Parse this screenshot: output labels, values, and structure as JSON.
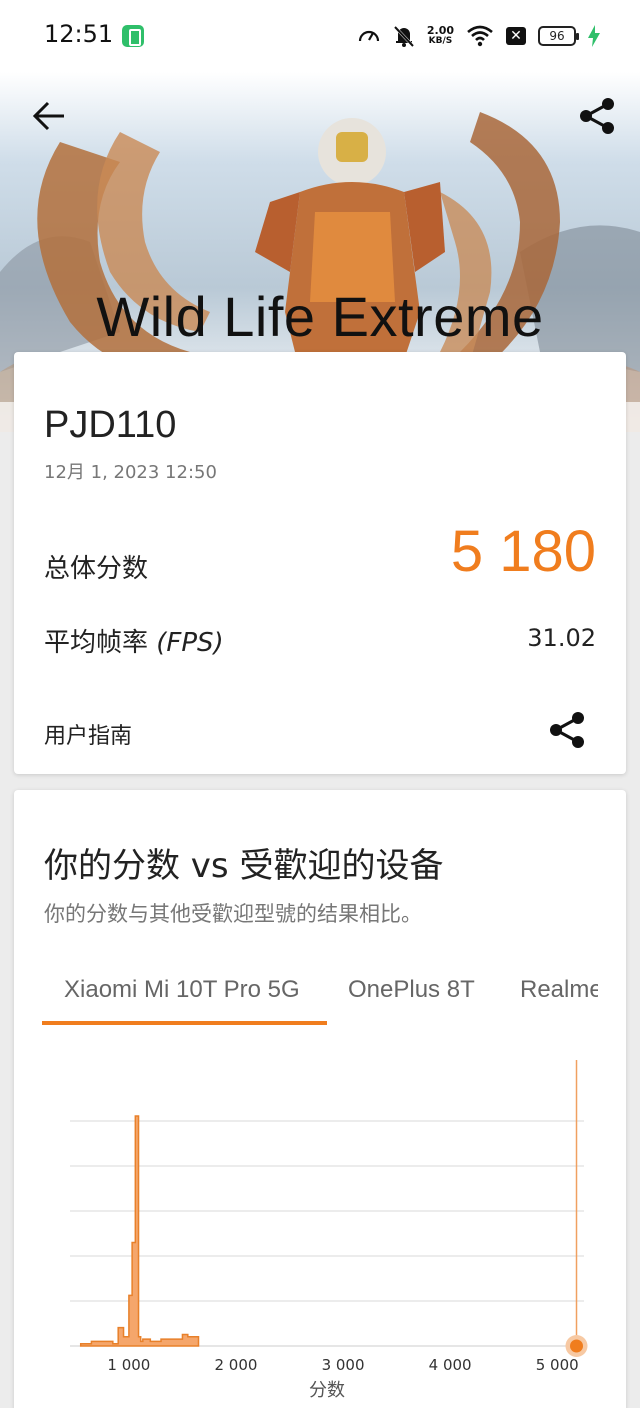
{
  "status_bar": {
    "time": "12:51",
    "net_speed_value": "2.00",
    "net_speed_unit": "KB/S",
    "battery": "96",
    "icons": [
      "app-notification-icon",
      "speedometer-icon",
      "mute-bell-icon",
      "wifi-icon",
      "close-box-icon",
      "battery-icon",
      "charging-bolt-icon"
    ]
  },
  "hero": {
    "title": "Wild Life Extreme",
    "back_icon": "back-arrow-icon",
    "share_icon": "share-icon"
  },
  "result": {
    "device": "PJD110",
    "date": "12月 1, 2023 12:50",
    "overall_label": "总体分数",
    "overall_score": "5 180",
    "fps_label_prefix": "平均帧率 ",
    "fps_label_italic": "(FPS)",
    "fps_value": "31.02",
    "guide_label": "用户指南",
    "accent_color": "#f07d1e"
  },
  "compare": {
    "title": "你的分数 vs 受歡迎的设备",
    "subtitle": "你的分数与其他受歡迎型號的结果相比。",
    "tabs": [
      "Xiaomi Mi 10T Pro 5G",
      "OnePlus 8T",
      "Realme"
    ],
    "active_tab": 0
  },
  "chart_data": {
    "type": "area",
    "xlabel": "分数",
    "x_ticks": [
      "1 000",
      "2 000",
      "3 000",
      "4 000",
      "5 000"
    ],
    "x_tick_values": [
      1000,
      2000,
      3000,
      4000,
      5000
    ],
    "xlim": [
      450,
      5250
    ],
    "ylim": [
      0,
      100
    ],
    "grid": true,
    "series": [
      {
        "x": [
          550,
          650,
          750,
          850,
          900,
          950,
          1000,
          1030,
          1050,
          1060,
          1080,
          1090,
          1110,
          1130,
          1150,
          1200,
          1300,
          1400,
          1500,
          1550,
          1600
        ],
        "y": [
          1,
          2,
          2,
          1,
          8,
          4,
          22,
          45,
          45,
          100,
          100,
          4,
          2,
          3,
          3,
          2,
          3,
          3,
          5,
          4,
          4
        ]
      }
    ],
    "your_score": 5180,
    "color": "#f5a66b",
    "line_color": "#e8802a"
  }
}
